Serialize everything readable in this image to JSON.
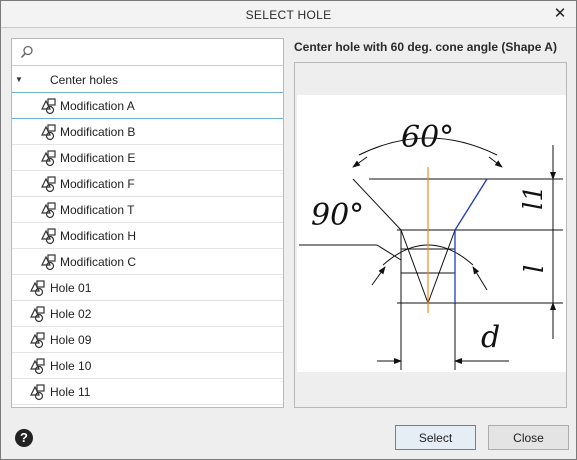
{
  "window": {
    "title": "SELECT HOLE",
    "close_glyph": "✕"
  },
  "search": {
    "placeholder": "",
    "value": ""
  },
  "tree": {
    "group": {
      "label": "Center holes",
      "expanded": true
    },
    "children": [
      {
        "label": "Modification A",
        "selected": true
      },
      {
        "label": "Modification B"
      },
      {
        "label": "Modification E"
      },
      {
        "label": "Modification F"
      },
      {
        "label": "Modification T"
      },
      {
        "label": "Modification H"
      },
      {
        "label": "Modification C"
      }
    ],
    "top_items": [
      {
        "label": "Hole 01"
      },
      {
        "label": "Hole 02"
      },
      {
        "label": "Hole 09"
      },
      {
        "label": "Hole 10"
      },
      {
        "label": "Hole 11"
      }
    ]
  },
  "preview": {
    "title": "Center hole with 60 deg. cone angle (Shape A)",
    "dimension_labels": {
      "angle_top": "60°",
      "angle_left": "90°",
      "l1": "l1",
      "l": "l",
      "d": "d"
    },
    "colors": {
      "axis": "#f08a24",
      "profile": "#1f3fbf",
      "lines": "#111111"
    }
  },
  "footer": {
    "help_glyph": "?",
    "select_label": "Select",
    "close_label": "Close"
  }
}
